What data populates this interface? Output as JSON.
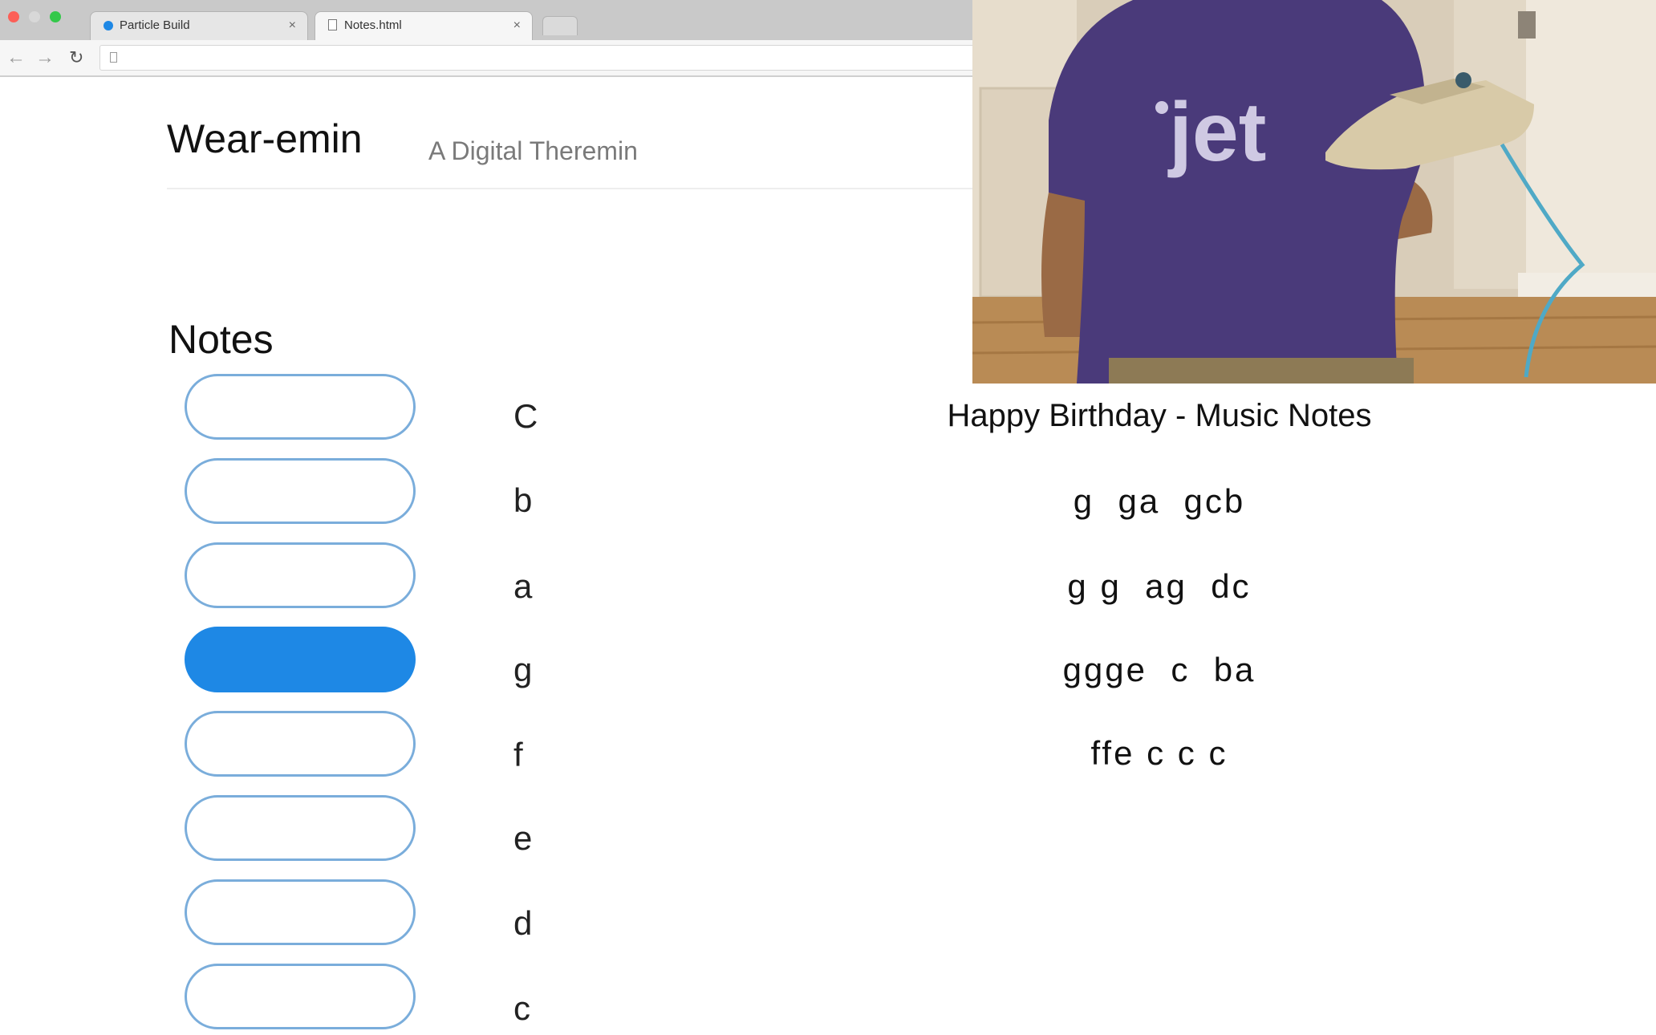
{
  "browser": {
    "tabs": [
      {
        "label": "Particle Build",
        "active": false
      },
      {
        "label": "Notes.html",
        "active": true
      }
    ],
    "close_glyph": "×"
  },
  "header": {
    "title": "Wear-emin",
    "subtitle": "A Digital Theremin"
  },
  "notes": {
    "heading": "Notes",
    "keys": [
      {
        "label": "C",
        "active": false
      },
      {
        "label": "b",
        "active": false
      },
      {
        "label": "a",
        "active": false
      },
      {
        "label": "g",
        "active": true
      },
      {
        "label": "f",
        "active": false
      },
      {
        "label": "e",
        "active": false
      },
      {
        "label": "d",
        "active": false
      },
      {
        "label": "c",
        "active": false
      }
    ]
  },
  "song": {
    "title": "Happy Birthday - Music Notes",
    "lines": [
      "g  ga  gcb",
      "g g  ag  dc",
      "ggge  c  ba",
      "ffe c c c"
    ]
  },
  "video": {
    "shirt_text": "jet"
  },
  "colors": {
    "key_active": "#1e88e5",
    "key_border": "#7aaddb",
    "shirt": "#4a3a7a"
  },
  "icons": [
    "back-arrow-icon",
    "forward-arrow-icon",
    "reload-icon",
    "page-icon",
    "favicon-icon"
  ]
}
